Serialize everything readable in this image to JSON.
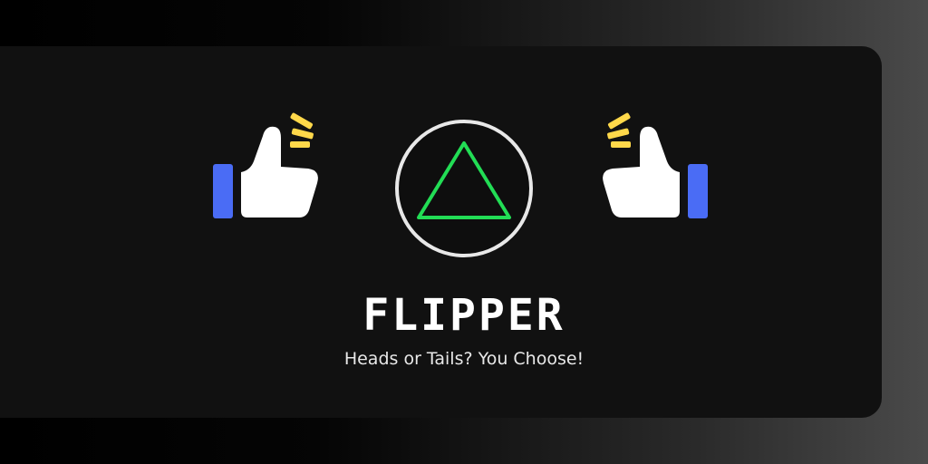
{
  "brand": {
    "title": "FLIPPER",
    "tagline": "Heads or Tails? You Choose!"
  },
  "icons": {
    "left": "thumbs-up-icon",
    "right": "thumbs-up-icon",
    "center": "triangle-icon"
  },
  "colors": {
    "card_background": "#111111",
    "cuff_blue": "#4a6cf5",
    "spark_yellow": "#ffd84a",
    "triangle_green": "#22dd55",
    "coin_ring": "#e8e8e8",
    "text": "#ffffff"
  }
}
